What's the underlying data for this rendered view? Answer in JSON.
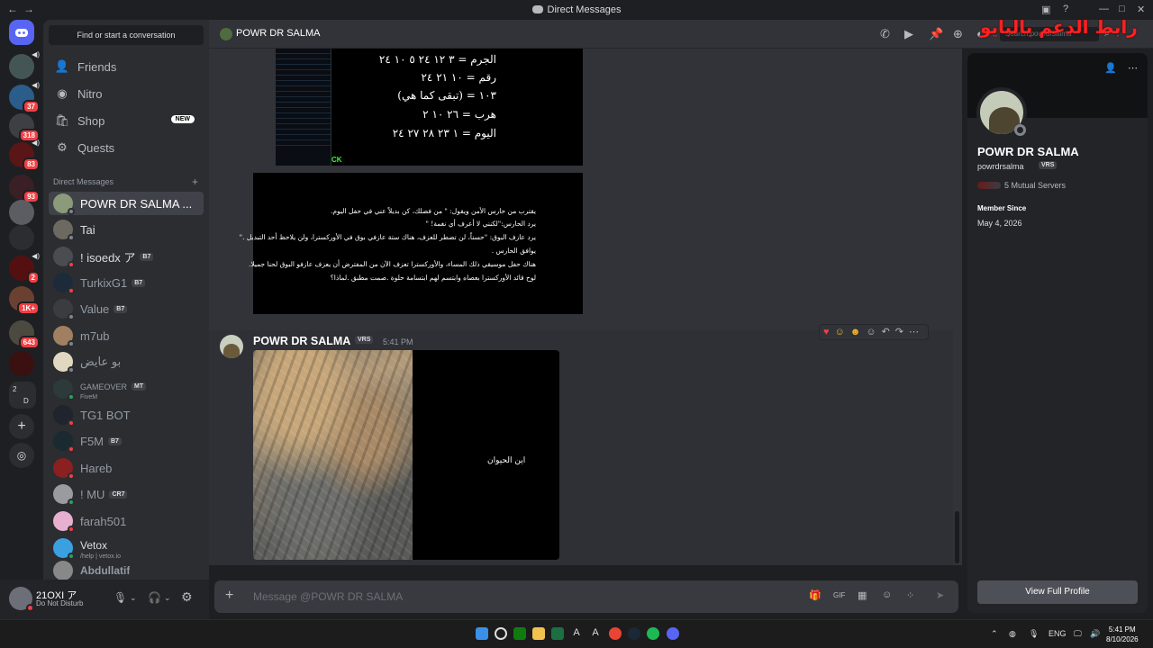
{
  "window": {
    "title": "Direct Messages",
    "overlay_text": "رابط الدعم بالبايو"
  },
  "guilds": [
    {
      "badge": ""
    },
    {
      "badge": "37"
    },
    {
      "badge": "318"
    },
    {
      "badge": "83"
    },
    {
      "badge": "93"
    },
    {
      "badge": ""
    },
    {
      "badge": ""
    },
    {
      "badge": "2"
    },
    {
      "badge": "1K+"
    },
    {
      "badge": "643"
    },
    {
      "badge": ""
    }
  ],
  "guild_folder": {
    "top": "2",
    "bottom": "D"
  },
  "sidebar": {
    "find_label": "Find or start a conversation",
    "nav": [
      {
        "label": "Friends",
        "icon": "friends-icon"
      },
      {
        "label": "Nitro",
        "icon": "nitro-icon"
      },
      {
        "label": "Shop",
        "icon": "shop-icon",
        "tag": "NEW"
      },
      {
        "label": "Quests",
        "icon": "quests-icon"
      }
    ],
    "dm_header": "Direct Messages",
    "dms": [
      {
        "name": "POWR DR SALMA ...",
        "status": "offline",
        "active": true
      },
      {
        "name": "Tai",
        "status": "offline"
      },
      {
        "name": "! isoedx ア",
        "tag": "B7",
        "status": "dnd"
      },
      {
        "name": "TurkixG1",
        "tag": "B7",
        "status": "dnd"
      },
      {
        "name": "Value",
        "tag": "B7",
        "status": "offline"
      },
      {
        "name": "m7ub",
        "status": "offline"
      },
      {
        "name": "بو عايض",
        "status": "offline"
      },
      {
        "name": "GAMEOVER",
        "tag": "MT",
        "sub": "FiveM",
        "status": "online"
      },
      {
        "name": "TG1 BOT",
        "status": "dnd"
      },
      {
        "name": "F5M",
        "tag": "B7",
        "status": "dnd"
      },
      {
        "name": "Hareb",
        "status": "dnd"
      },
      {
        "name": "! MU",
        "tag": "CR7",
        "status": "online"
      },
      {
        "name": "farah501",
        "status": "dnd"
      },
      {
        "name": "Vetox",
        "sub": "/help | vetox.io",
        "status": "online"
      },
      {
        "name": "Abdullatif",
        "status": "offline"
      }
    ]
  },
  "user": {
    "name": "21OXI ア",
    "status": "Do Not Disturb"
  },
  "header": {
    "name": "POWR DR SALMA",
    "search_placeholder": "Search powrdrsalma"
  },
  "chat": {
    "image1_lines": [
      "الجرم = ٣ ١٢ ٢٤ ٥ ١٠ ٢٤",
      "رقم = ١٠ ٢١ ٢٤",
      "١٠٣ = (تبقى كما هي)",
      "هرب = ٢٦ ١٠ ٢",
      "اليوم = ١ ٢٣ ٢٨ ٢٧ ٢٤"
    ],
    "image1_corner": "CK",
    "image2_lines": [
      "يقترب من حارس الأمن ويقول: \" من فضلك، كن بديلاً عني في حفل اليوم.",
      "يرد الحارس:\"لكنني لا أعرف أي نغمة! \"",
      "يرد عازف البوق: \"حسناً، لن تضطر للعزف، هناك ستة عازفي بوق في الأوركسترا، ولن يلاحظ أحد التبديل .\"",
      "يوافق الحارس .",
      "هناك حفل موسيقي ذلك المساء، والأوركسترا تعزف الآن من المفترض أن يعزف عازفو البوق لحنا جميلا.",
      "لوح قائد الأوركسترا بعصاه وابتسم لهم ابتسامة حلوة .صمت مطبق .لماذا؟"
    ],
    "message": {
      "author": "POWR DR SALMA",
      "tag": "VRS",
      "time": "5:41 PM",
      "image_caption": "اين الحيوان"
    },
    "reactions": [
      "heart",
      "smile",
      "laugh"
    ],
    "composer_placeholder": "Message @POWR DR SALMA"
  },
  "profile": {
    "name": "POWR DR SALMA",
    "username": "powrdrsalma",
    "tag": "VRS",
    "mutual": "5 Mutual Servers",
    "member_since_label": "Member Since",
    "member_since": "May 4, 2026",
    "view_full": "View Full Profile"
  },
  "taskbar": {
    "time": "5:41 PM",
    "date": "8/10/2026",
    "lang": "ENG"
  },
  "colors": {
    "accent": "#5865f2",
    "dnd": "#f23f43",
    "online": "#23a55a",
    "background": "#313338"
  }
}
